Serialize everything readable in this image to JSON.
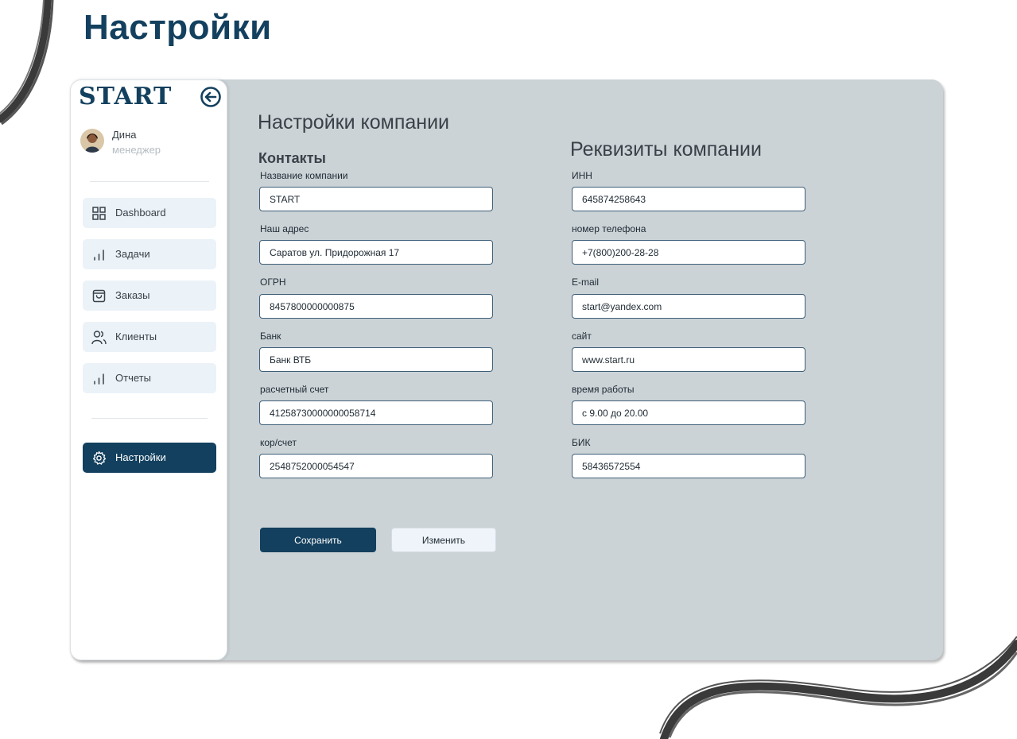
{
  "page": {
    "title": "Настройки"
  },
  "sidebar": {
    "logo": "START",
    "user": {
      "name": "Дина",
      "role": "менеджер"
    },
    "items": [
      {
        "label": "Dashboard",
        "icon": "grid-icon"
      },
      {
        "label": "Задачи",
        "icon": "bar-chart-icon"
      },
      {
        "label": "Заказы",
        "icon": "shopping-bag-icon"
      },
      {
        "label": "Клиенты",
        "icon": "users-icon"
      },
      {
        "label": "Отчеты",
        "icon": "bar-chart-icon"
      }
    ],
    "settings": {
      "label": "Настройки",
      "icon": "gear-icon"
    }
  },
  "main": {
    "section_title": "Настройки компании",
    "contacts": {
      "heading": "Контакты",
      "fields": [
        {
          "label": "Название компании",
          "value": "START"
        },
        {
          "label": "Наш адрес",
          "value": "Саратов ул. Придорожная 17"
        },
        {
          "label": "ОГРН",
          "value": "8457800000000875"
        },
        {
          "label": "Банк",
          "value": "Банк ВТБ"
        },
        {
          "label": "расчетный счет",
          "value": "41258730000000058714"
        },
        {
          "label": "кор/счет",
          "value": "2548752000054547"
        }
      ]
    },
    "requisites": {
      "heading": "Реквизиты  компании",
      "fields": [
        {
          "label": "ИНН",
          "value": "645874258643"
        },
        {
          "label": "номер телефона",
          "value": "+7(800)200-28-28"
        },
        {
          "label": "E-mail",
          "value": "start@yandex.com"
        },
        {
          "label": "сайт",
          "value": "www.start.ru"
        },
        {
          "label": "время работы",
          "value": "с 9.00 до 20.00"
        },
        {
          "label": "БИК",
          "value": "58436572554"
        }
      ]
    },
    "buttons": {
      "save": "Сохранить",
      "edit": "Изменить"
    }
  },
  "colors": {
    "accent": "#13405e",
    "panel": "#cbd3d7",
    "nav_bg": "#ebf2f8"
  }
}
